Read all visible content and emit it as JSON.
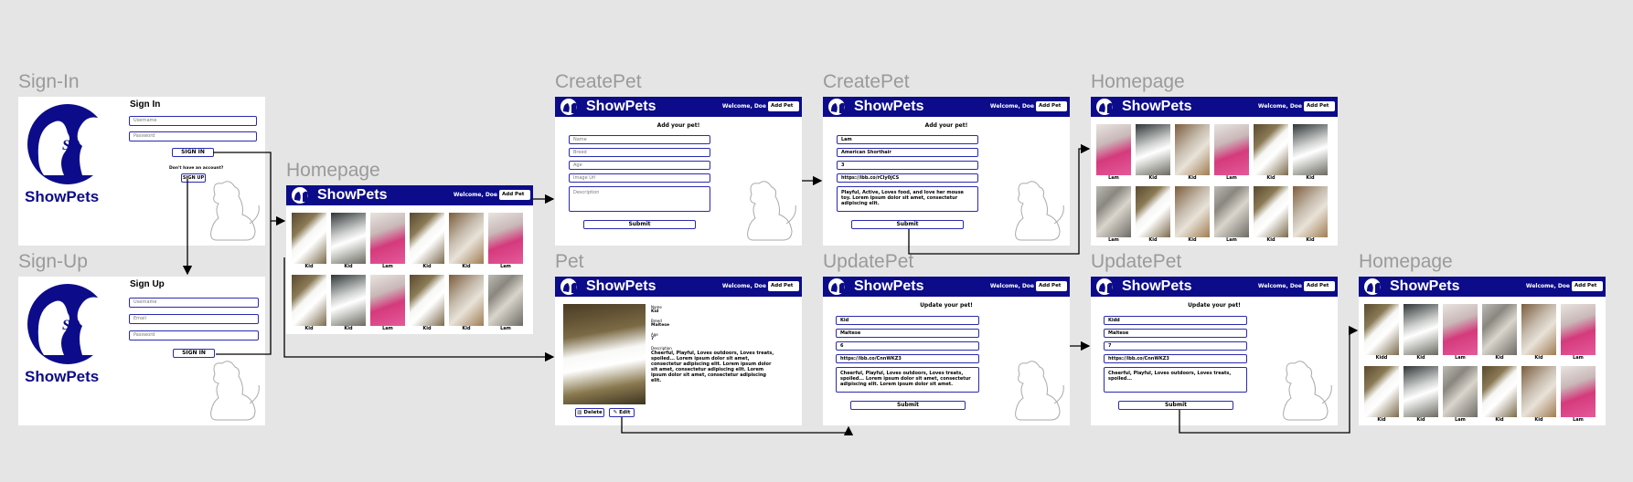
{
  "brand": "ShowPets",
  "welcome": "Welcome, Doe",
  "add_pet": "Add Pet",
  "colors": {
    "navy": "#0c0c8a",
    "field_border": "#2a2ab0",
    "canvas": "#e5e5e5",
    "label": "#9a9a9a"
  },
  "frame_labels": {
    "signin": "Sign-In",
    "signup": "Sign-Up",
    "home1": "Homepage",
    "create1": "CreatePet",
    "create2": "CreatePet",
    "pet": "Pet",
    "update1": "UpdatePet",
    "update2": "UpdatePet",
    "home2": "Homepage",
    "home3": "Homepage"
  },
  "signin": {
    "logo_text": "SP",
    "title": "Sign In",
    "username_placeholder": "Username",
    "password_placeholder": "Password",
    "submit": "SIGN IN",
    "prompt": "Don't have an account?",
    "signup_link": "SIGN UP"
  },
  "signup": {
    "logo_text": "SP",
    "title": "Sign Up",
    "username_placeholder": "Username",
    "email_placeholder": "Email",
    "password_placeholder": "Password",
    "submit": "SIGN IN"
  },
  "home1": {
    "captions": [
      "Kid",
      "Kid",
      "Lam",
      "Kid",
      "Kid",
      "Lam",
      "Kid",
      "Kid",
      "Lam",
      "Kid",
      "Kid",
      "Lam"
    ]
  },
  "home2": {
    "captions": [
      "Lam",
      "Kid",
      "Kid",
      "Lam",
      "Kid",
      "Kid",
      "Lam",
      "Kid",
      "Kid",
      "Lam",
      "Kid",
      "Kid"
    ]
  },
  "home3": {
    "captions": [
      "Kidd",
      "Kid",
      "Lam",
      "Kid",
      "Kid",
      "Lam",
      "Kid",
      "Kid",
      "Lam",
      "Kid",
      "Kid",
      "Lam"
    ]
  },
  "create1": {
    "heading": "Add your pet!",
    "name_placeholder": "Name",
    "breed_placeholder": "Breed",
    "age_placeholder": "Age",
    "image_placeholder": "Image Url",
    "description_placeholder": "Description",
    "submit": "Submit"
  },
  "create2": {
    "heading": "Add your pet!",
    "name": "Lam",
    "breed": "American Shorthair",
    "age": "3",
    "image_url": "https://ibb.co/rCly0jCS",
    "description": "Playful, Active, Loves food, and love her mouse toy. Lorem ipsum dolor sit amet, consectetur adipiscing elit.",
    "submit": "Submit"
  },
  "pet": {
    "name_label": "Name",
    "name": "Kid",
    "breed_label": "Breed",
    "breed": "Maltese",
    "age_label": "Age",
    "age": "7",
    "description_label": "Description",
    "description": "Cheerful, Playful, Loves outdoors, Loves treats, spoiled... Lorem ipsum dolor sit amet, consectetur adipiscing elit. Lorem ipsum dolor sit amet, consectetur adipiscing elit. Lorem ipsum dolor sit amet, consectetur adipiscing elit.",
    "delete": "Delete",
    "edit": "Edit"
  },
  "update1": {
    "heading": "Update your pet!",
    "name": "Kid",
    "breed": "Maltese",
    "age": "6",
    "image_url": "https://ibb.co/CnnWKZ3",
    "description": "Cheerful, Playful, Loves outdoors, Loves treats, spoiled... Lorem ipsum dolor sit amet, consectetur adipiscing elit. Lorem ipsum dolor sit amet.",
    "submit": "Submit"
  },
  "update2": {
    "heading": "Update your pet!",
    "name": "Kidd",
    "breed": "Maltese",
    "age": "7",
    "image_url": "https://ibb.co/CnnWKZ3",
    "description": "Cheerful, Playful, Loves outdoors, Loves treats, spoiled...",
    "submit": "Submit"
  }
}
